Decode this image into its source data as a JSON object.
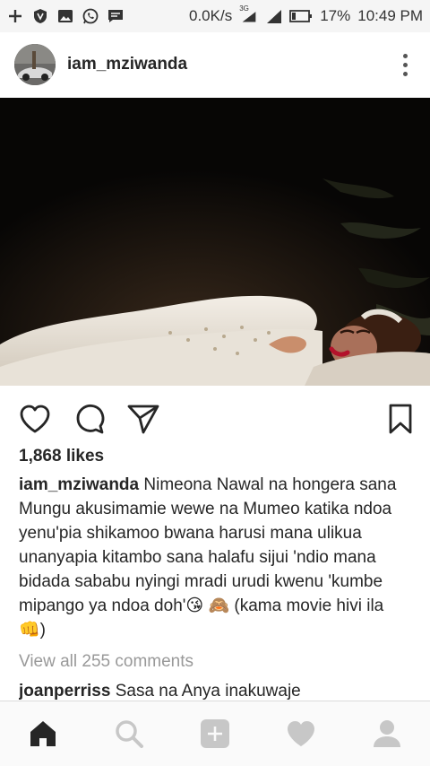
{
  "status_bar": {
    "icons_left": [
      "plus-icon",
      "shield-icon",
      "image-icon",
      "whatsapp-icon",
      "message-icon"
    ],
    "network_speed": "0.0K/s",
    "network_type": "3G",
    "battery_percent": "17%",
    "time": "10:49 PM"
  },
  "post": {
    "username": "iam_mziwanda",
    "likes": "1,868 likes",
    "caption_user": "iam_mziwanda",
    "caption_text": "Nimeona Nawal na hongera sana Mungu akusimamie wewe na Mumeo katika ndoa yenu'pia shikamoo bwana harusi mana ulikua unanyapia kitambo sana halafu sijui 'ndio mana bidada sababu nyingi mradi urudi kwenu 'kumbe mipango ya ndoa doh'😘 🙈 (kama movie hivi ila 👊)",
    "view_comments": "View all 255 comments",
    "comment_user": "joanperriss",
    "comment_text": "Sasa na Anya inakuwaje"
  },
  "actions": [
    "heart-icon",
    "comment-icon",
    "share-icon",
    "bookmark-icon"
  ],
  "bottom_nav": [
    "home-icon",
    "search-icon",
    "add-icon",
    "activity-icon",
    "profile-icon"
  ],
  "colors": {
    "text": "#262626",
    "muted": "#999999",
    "icon": "#262626",
    "nav_icon_inactive": "#c7c7c7",
    "photo_bg": "#070605"
  }
}
